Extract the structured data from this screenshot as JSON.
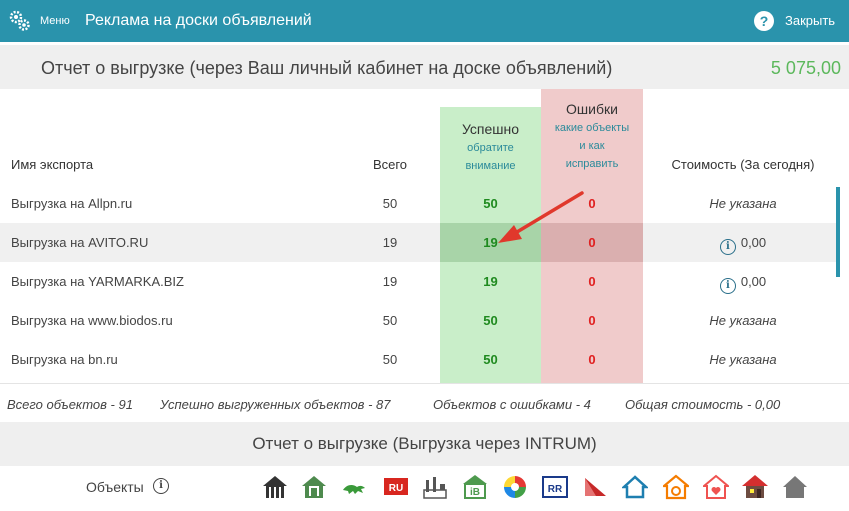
{
  "header": {
    "menu_label": "Меню",
    "title": "Реклама на доски объявлений",
    "help_glyph": "?",
    "close_label": "Закрыть"
  },
  "report": {
    "title": "Отчет о выгрузке (через Ваш личный кабинет на доске объявлений)",
    "total": "5 075,00"
  },
  "table": {
    "headers": {
      "name": "Имя экспорта",
      "total": "Всего",
      "success": "Успешно",
      "success_sub": [
        "обратите",
        "внимание"
      ],
      "errors": "Ошибки",
      "errors_sub": [
        "какие объекты",
        "и как",
        "исправить"
      ],
      "cost": "Стоимость (За сегодня)"
    },
    "rows": [
      {
        "name": "Выгрузка на Allpn.ru",
        "total": "50",
        "success": "50",
        "errors": "0",
        "cost": "Не указана"
      },
      {
        "name": "Выгрузка на AVITO.RU",
        "total": "19",
        "success": "19",
        "errors": "0",
        "cost": "0,00"
      },
      {
        "name": "Выгрузка на YARMARKA.BIZ",
        "total": "19",
        "success": "19",
        "errors": "0",
        "cost": "0,00"
      },
      {
        "name": "Выгрузка на www.biodos.ru",
        "total": "50",
        "success": "50",
        "errors": "0",
        "cost": "Не указана"
      },
      {
        "name": "Выгрузка на bn.ru",
        "total": "50",
        "success": "50",
        "errors": "0",
        "cost": "Не указана"
      }
    ],
    "info_glyph": "i"
  },
  "summary": {
    "all": "Всего объектов - 91",
    "success": "Успешно выгруженных объектов - 87",
    "errors": "Объектов с ошибками - 4",
    "cost": "Общая стоимость - 0,00"
  },
  "intrum": {
    "title": "Отчет о выгрузке (Выгрузка через INTRUM)",
    "objects_label": "Объекты",
    "info_glyph": "i",
    "ru_badge": "RU",
    "ib_badge": "iB",
    "rr_badge": "RR"
  },
  "colors": {
    "accent": "#2a93ac",
    "success": "#1f8a1f",
    "error": "#e02020",
    "total": "#5cb85c",
    "arrow": "#e0382c"
  }
}
